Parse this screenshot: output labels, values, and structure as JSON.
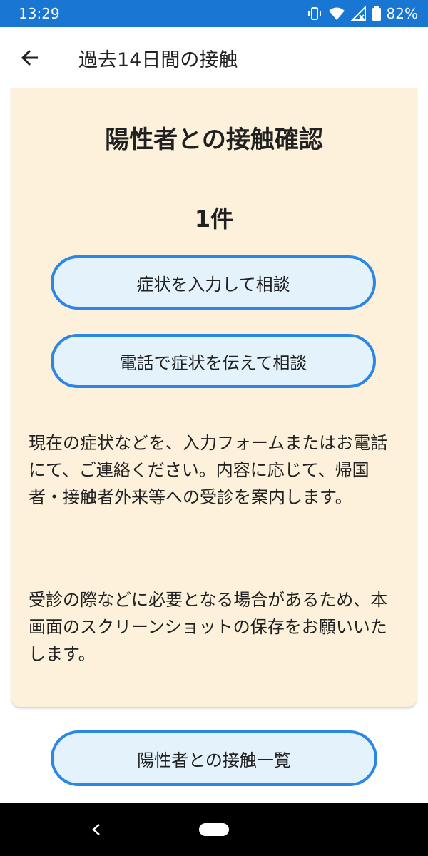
{
  "status_bar": {
    "time": "13:29",
    "battery": "82%",
    "icons": [
      "vibrate-icon",
      "wifi-icon",
      "no-signal-icon",
      "battery-icon"
    ]
  },
  "app_bar": {
    "title": "過去14日間の接触",
    "back_icon": "arrow-back-icon"
  },
  "card": {
    "title": "陽性者との接触確認",
    "count": "1件",
    "buttons": [
      {
        "label": "症状を入力して相談"
      },
      {
        "label": "電話で症状を伝えて相談"
      }
    ],
    "paragraphs": [
      "現在の症状などを、入力フォームまたはお電話にて、ご連絡ください。内容に応じて、帰国者・接触者外来等への受診を案内します。",
      "受診の際などに必要となる場合があるため、本画面のスクリーンショットの保存をお願いいたします。"
    ]
  },
  "list_button": {
    "label": "陽性者との接触一覧"
  },
  "colors": {
    "status_bar": "#1976d2",
    "card_background": "#fdf1dc",
    "button_border": "#2b86e5",
    "button_fill": "#e4f2fb",
    "accent_circle": "#f6c342"
  }
}
